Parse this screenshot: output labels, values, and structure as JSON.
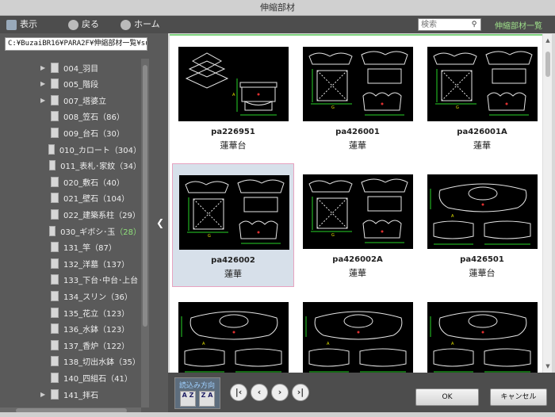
{
  "window": {
    "title": "伸縮部材"
  },
  "toolbar": {
    "view_label": "表示",
    "back_label": "戻る",
    "home_label": "ホーム",
    "search_placeholder": "検索",
    "breadcrumb": "伸縮部材一覧"
  },
  "left": {
    "path": "C:¥BuzaiBR16¥PARA2F¥伸縮部材一覧¥su",
    "tree": [
      {
        "label": "004_羽目",
        "count": "",
        "expandable": true,
        "count_highlight": false
      },
      {
        "label": "005_階段",
        "count": "",
        "expandable": true,
        "count_highlight": false
      },
      {
        "label": "007_塔婆立",
        "count": "",
        "expandable": true,
        "count_highlight": false
      },
      {
        "label": "008_笠石",
        "count": "（86）",
        "expandable": false,
        "count_highlight": false
      },
      {
        "label": "009_台石",
        "count": "（30）",
        "expandable": false,
        "count_highlight": false
      },
      {
        "label": "010_カロート",
        "count": "（304）",
        "expandable": false,
        "count_highlight": false
      },
      {
        "label": "011_表札･家紋",
        "count": "（34）",
        "expandable": false,
        "count_highlight": false
      },
      {
        "label": "020_敷石",
        "count": "（40）",
        "expandable": false,
        "count_highlight": false
      },
      {
        "label": "021_壁石",
        "count": "（104）",
        "expandable": false,
        "count_highlight": false
      },
      {
        "label": "022_建築系柱",
        "count": "（29）",
        "expandable": false,
        "count_highlight": false
      },
      {
        "label": "030_ギボシ･玉",
        "count": "（28）",
        "expandable": false,
        "count_highlight": true
      },
      {
        "label": "131_竿",
        "count": "（87）",
        "expandable": false,
        "count_highlight": false
      },
      {
        "label": "132_洋墓",
        "count": "（137）",
        "expandable": false,
        "count_highlight": false
      },
      {
        "label": "133_下台･中台･上台",
        "count": "",
        "expandable": false,
        "count_highlight": false
      },
      {
        "label": "134_スリン",
        "count": "（36）",
        "expandable": false,
        "count_highlight": false
      },
      {
        "label": "135_花立",
        "count": "（123）",
        "expandable": false,
        "count_highlight": false
      },
      {
        "label": "136_水鉢",
        "count": "（123）",
        "expandable": false,
        "count_highlight": false
      },
      {
        "label": "137_香炉",
        "count": "（122）",
        "expandable": false,
        "count_highlight": false
      },
      {
        "label": "138_切出水鉢",
        "count": "（35）",
        "expandable": false,
        "count_highlight": false
      },
      {
        "label": "140_四組石",
        "count": "（41）",
        "expandable": false,
        "count_highlight": false
      },
      {
        "label": "141_拝石",
        "count": "",
        "expandable": true,
        "count_highlight": false
      }
    ]
  },
  "grid": {
    "items": [
      {
        "code": "pa226951",
        "name": "蓮華台",
        "kind": "base",
        "selected": false
      },
      {
        "code": "pa426001",
        "name": "蓮華",
        "kind": "lotus",
        "selected": false
      },
      {
        "code": "pa426001A",
        "name": "蓮華",
        "kind": "lotus",
        "selected": false
      },
      {
        "code": "pa426002",
        "name": "蓮華",
        "kind": "lotus",
        "selected": true
      },
      {
        "code": "pa426002A",
        "name": "蓮華",
        "kind": "lotus",
        "selected": false
      },
      {
        "code": "pa426501",
        "name": "蓮華台",
        "kind": "oval",
        "selected": false
      },
      {
        "code": "",
        "name": "",
        "kind": "oval",
        "selected": false
      },
      {
        "code": "",
        "name": "",
        "kind": "oval",
        "selected": false
      },
      {
        "code": "",
        "name": "",
        "kind": "oval",
        "selected": false
      }
    ]
  },
  "bottom": {
    "sort_title": "読込み方向",
    "sort_az": "A Z",
    "sort_za": "Z A",
    "ok_label": "OK",
    "cancel_label": "キャンセル"
  },
  "colors": {
    "toolbar_bg": "#4d4d4d",
    "pane_bg": "#5a5a5a",
    "accent_green": "#7ed37e",
    "selection_bg": "#d7e0ea"
  }
}
